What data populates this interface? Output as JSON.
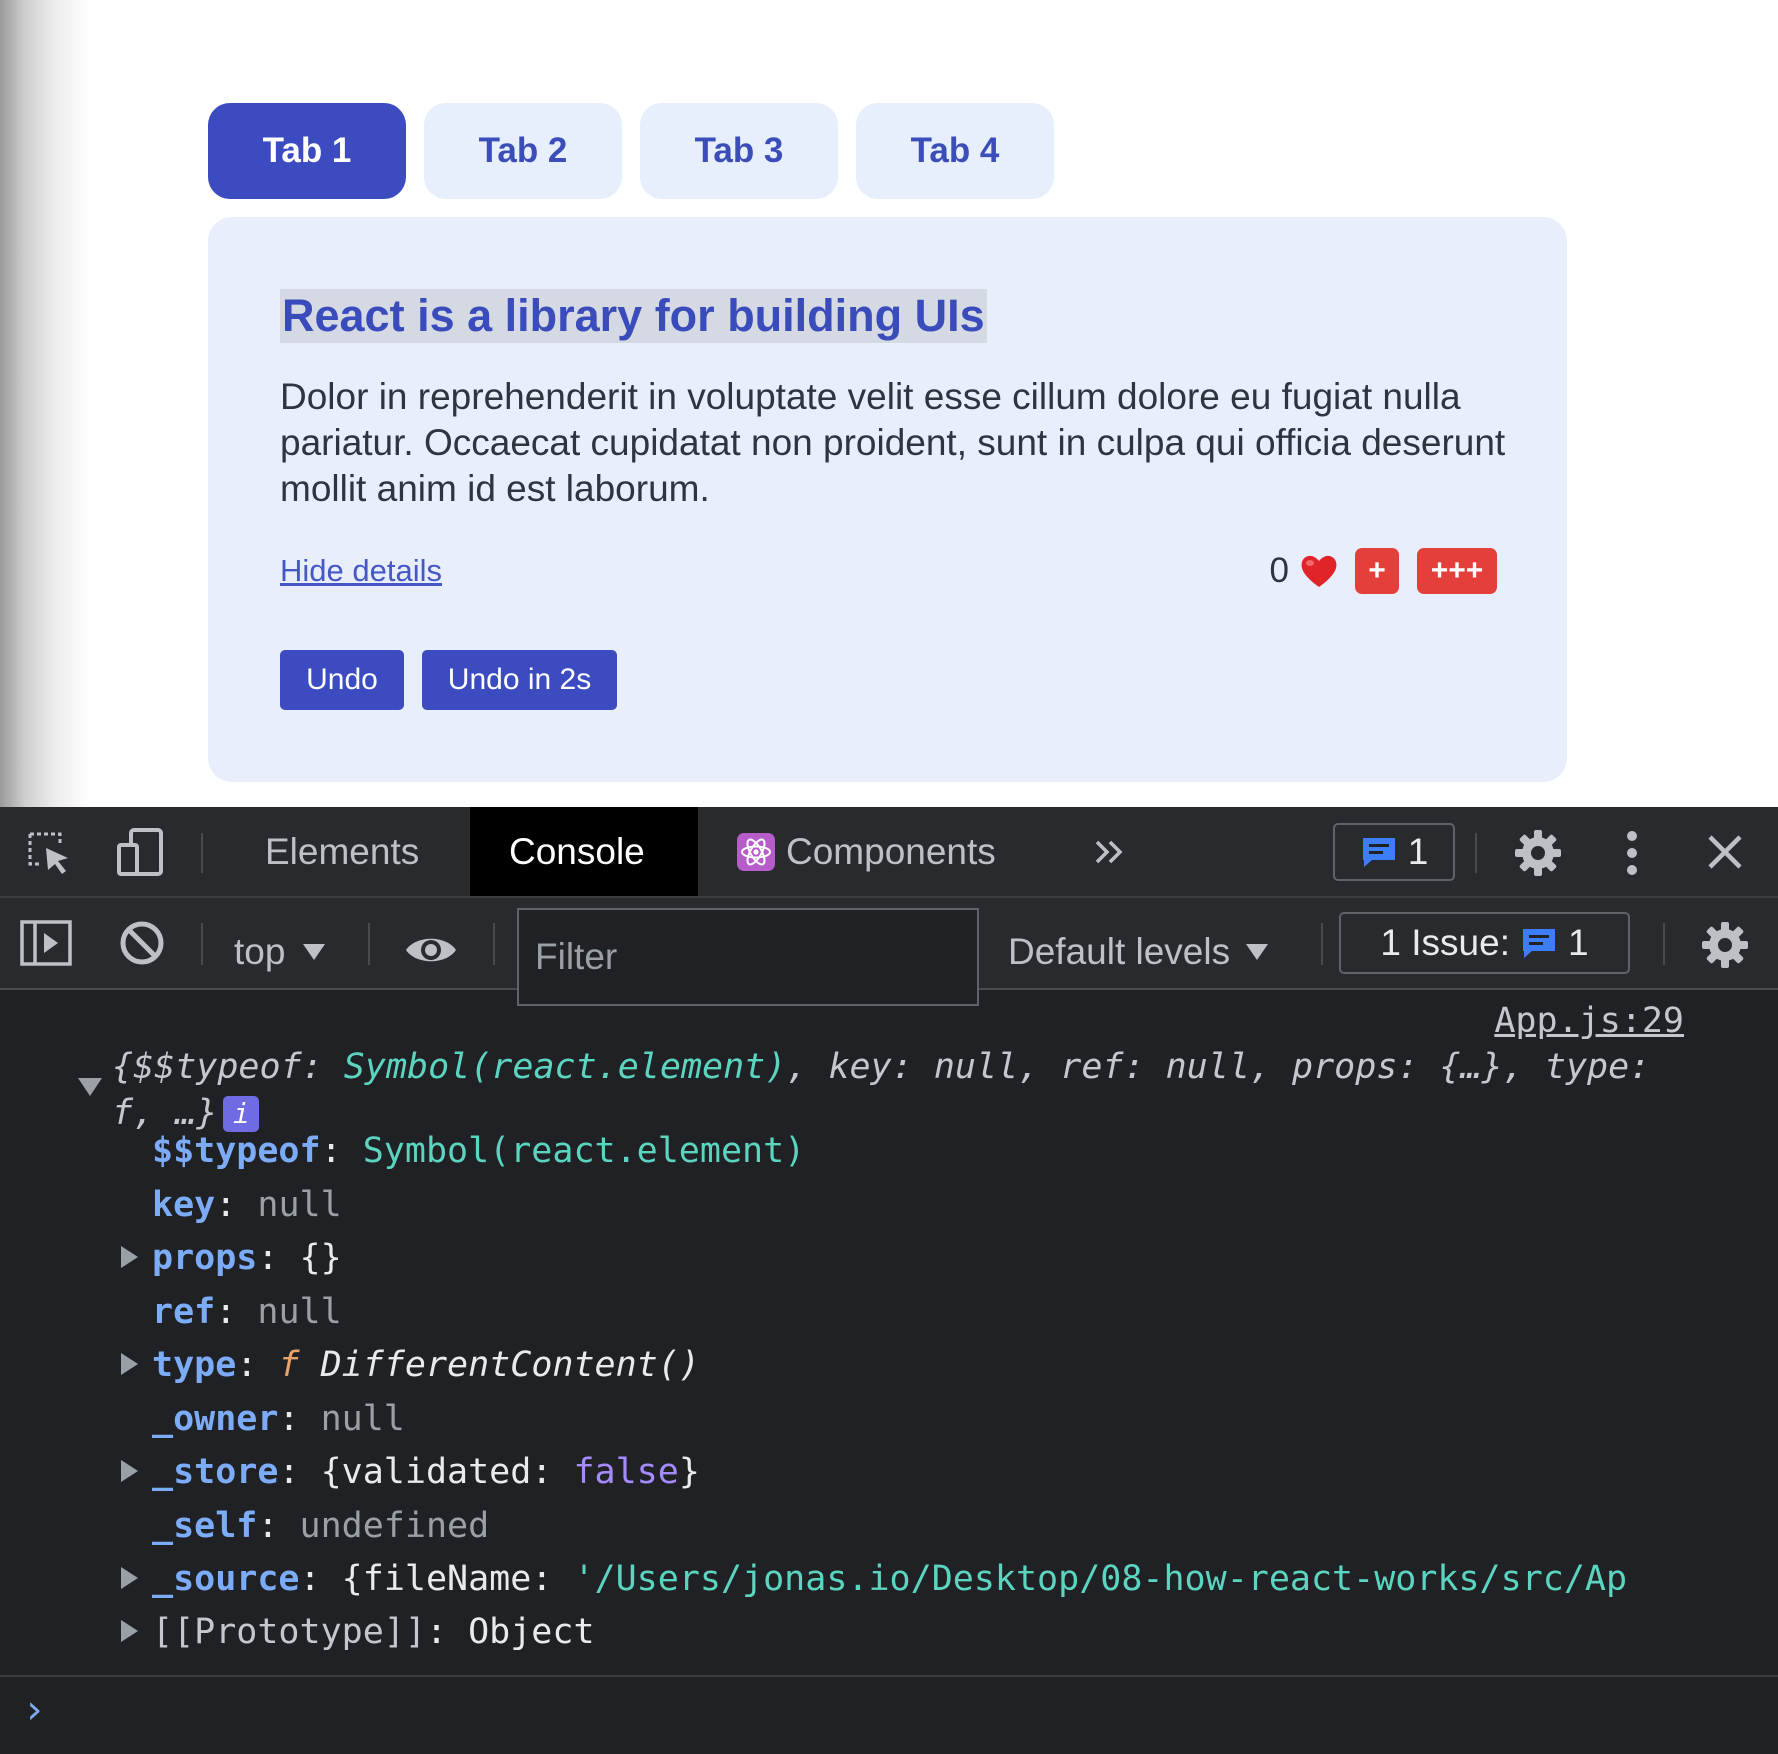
{
  "app": {
    "tabs": [
      {
        "label": "Tab 1",
        "active": true
      },
      {
        "label": "Tab 2",
        "active": false
      },
      {
        "label": "Tab 3",
        "active": false
      },
      {
        "label": "Tab 4",
        "active": false
      }
    ],
    "panel": {
      "title": "React is a library for building UIs",
      "text": "Dolor in reprehenderit in voluptate velit esse cillum dolore eu fugiat nulla pariatur. Occaecat cupidatat non proident, sunt in culpa qui officia deserunt mollit anim id est laborum.",
      "hide_link": "Hide details",
      "like_count": "0",
      "plus_label": "+",
      "plus3_label": "+++",
      "undo_label": "Undo",
      "undo2_label": "Undo in 2s"
    },
    "colors": {
      "accent": "#3c4cc0",
      "panel_bg": "#e8eefc",
      "danger": "#e3403b"
    }
  },
  "devtools": {
    "tabs": [
      "Elements",
      "Console",
      "Components"
    ],
    "active_tab": "Console",
    "messages_count": "1",
    "toolbar": {
      "context": "top",
      "filter_placeholder": "Filter",
      "levels": "Default levels",
      "issues_label": "1 Issue:",
      "issues_count": "1"
    },
    "console": {
      "source": "App.js:29",
      "summary_prefix": "{$$typeof: ",
      "summary_symbol": "Symbol(react.element)",
      "summary_rest": ", key: null, ref: null, props: {…}, type: f, …}",
      "info_icon_text": "i",
      "props": [
        {
          "key": "$$typeof",
          "value": "Symbol(react.element)"
        },
        {
          "key": "key",
          "value": "null"
        },
        {
          "key": "props",
          "value": "{}"
        },
        {
          "key": "ref",
          "value": "null"
        },
        {
          "key": "type",
          "fn_prefix": "f",
          "value": "DifferentContent()"
        },
        {
          "key": "_owner",
          "value": "null"
        },
        {
          "key": "_store",
          "value_prefix": "{validated: ",
          "value": "false",
          "value_suffix": "}"
        },
        {
          "key": "_self",
          "value": "undefined"
        },
        {
          "key": "_source",
          "value_prefix": "{fileName: ",
          "value": "'/Users/jonas.io/Desktop/08-how-react-works/src/Ap"
        },
        {
          "key": "[[Prototype]]",
          "value": "Object"
        }
      ],
      "prompt": "›"
    }
  }
}
